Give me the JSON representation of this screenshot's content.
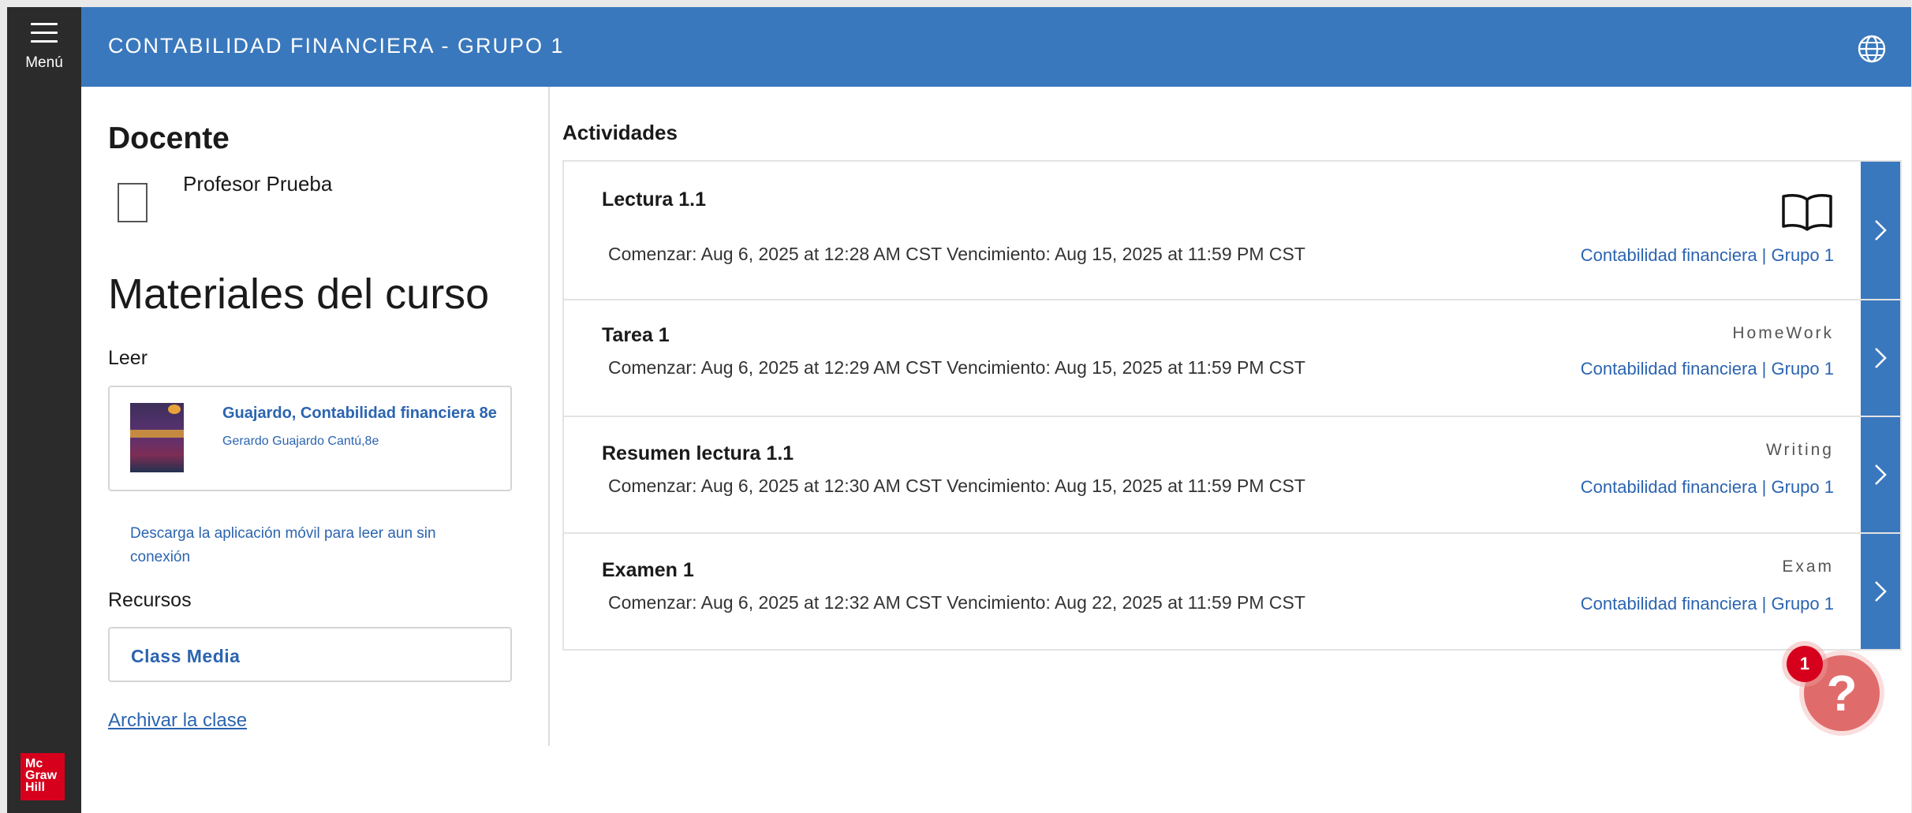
{
  "sidebar": {
    "menu_label": "Menú",
    "logo_text": "Mc Graw Hill"
  },
  "header": {
    "course_title": "CONTABILIDAD FINANCIERA - GRUPO 1",
    "globe_icon": "globe-icon"
  },
  "left": {
    "docente_heading": "Docente",
    "teacher_name": "Profesor Prueba",
    "materiales_heading": "Materiales del curso",
    "leer_label": "Leer",
    "book": {
      "title": "Guajardo, Contabilidad financiera 8e",
      "author": "Gerardo Guajardo Cantú,8e"
    },
    "download_text": "Descarga la aplicación móvil para leer aun sin conexión",
    "recursos_label": "Recursos",
    "class_media": "Class Media",
    "archivar": "Archivar la clase"
  },
  "activities": {
    "heading": "Actividades",
    "items": [
      {
        "title": "Lectura 1.1",
        "type": "",
        "icon": "book-open-icon",
        "dates": "Comenzar: Aug 6, 2025 at 12:28 AM CST  Vencimiento: Aug 15, 2025 at 11:59 PM CST",
        "course": "Contabilidad financiera | Grupo 1"
      },
      {
        "title": "Tarea 1",
        "type": "HomeWork",
        "dates": "Comenzar: Aug 6, 2025 at 12:29 AM CST  Vencimiento: Aug 15, 2025 at 11:59 PM CST",
        "course": "Contabilidad financiera | Grupo 1"
      },
      {
        "title": "Resumen lectura 1.1",
        "type": "Writing",
        "dates": "Comenzar: Aug 6, 2025 at 12:30 AM CST  Vencimiento: Aug 15, 2025 at 11:59 PM CST",
        "course": "Contabilidad financiera | Grupo 1"
      },
      {
        "title": "Examen 1",
        "type": "Exam",
        "dates": "Comenzar: Aug 6, 2025 at 12:32 AM CST  Vencimiento: Aug 22, 2025 at 11:59 PM CST",
        "course": "Contabilidad financiera | Grupo 1"
      }
    ]
  },
  "help": {
    "symbol": "?",
    "badge_count": "1"
  },
  "colors": {
    "brand_blue": "#3a78bd",
    "link_blue": "#2b64b0",
    "mh_red": "#d6001c",
    "help_red": "#e06b6b"
  }
}
